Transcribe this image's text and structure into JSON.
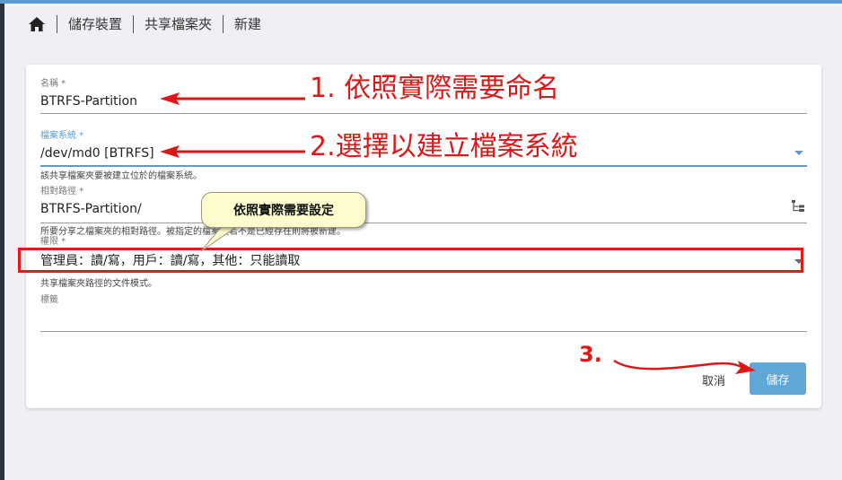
{
  "breadcrumb": {
    "home_icon": "home-icon",
    "items": [
      "儲存裝置",
      "共享檔案夾",
      "新建"
    ]
  },
  "form": {
    "name": {
      "label": "名稱 *",
      "value": "BTRFS-Partition"
    },
    "filesystem": {
      "label": "檔案系統 *",
      "value": "/dev/md0 [BTRFS]",
      "hint": "該共享檔案夾要被建立位於的檔案系統。"
    },
    "relpath": {
      "label": "相對路徑 *",
      "value": "BTRFS-Partition/",
      "hint": "所要分享之檔案夾的相對路徑。被指定的檔案夾若不是已經存在則將被新建。",
      "icon": "folder-tree-icon"
    },
    "permissions": {
      "label": "權限 *",
      "value": "管理員：讀/寫，用戶：讀/寫，其他：只能讀取",
      "hint": "共享檔案夾路徑的文件模式。"
    },
    "tags": {
      "label": "標籤",
      "value": ""
    }
  },
  "buttons": {
    "cancel": "取消",
    "save": "儲存"
  },
  "annotations": {
    "step1": "1. 依照實際需要命名",
    "step2": "2.選擇以建立檔案系統",
    "step3": "3.",
    "callout": "依照實際需要設定"
  },
  "colors": {
    "accent": "#5b9bd5",
    "save_button": "#5fa6d9",
    "annotation_red": "#e01616",
    "callout_bg": "#fefccc"
  }
}
